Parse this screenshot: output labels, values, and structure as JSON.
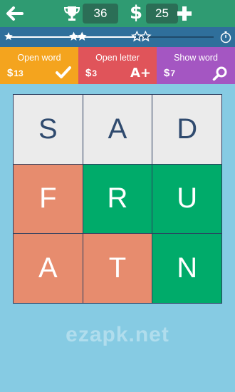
{
  "header": {
    "score": "36",
    "coins": "25",
    "dollar_symbol": "$"
  },
  "progress": {
    "fill_fraction": 0.62
  },
  "hints": [
    {
      "label": "Open word",
      "price": "13",
      "currency": "$",
      "icon": "checkmark-icon"
    },
    {
      "label": "Open letter",
      "price": "3",
      "currency": "$",
      "icon": "a-plus-icon",
      "icon_text": "A+"
    },
    {
      "label": "Show word",
      "price": "7",
      "currency": "$",
      "icon": "magnifier-icon"
    }
  ],
  "grid": {
    "cells": [
      {
        "letter": "S",
        "state": "neutral"
      },
      {
        "letter": "A",
        "state": "neutral"
      },
      {
        "letter": "D",
        "state": "neutral"
      },
      {
        "letter": "F",
        "state": "salmon"
      },
      {
        "letter": "R",
        "state": "green"
      },
      {
        "letter": "U",
        "state": "green"
      },
      {
        "letter": "A",
        "state": "salmon"
      },
      {
        "letter": "T",
        "state": "salmon"
      },
      {
        "letter": "N",
        "state": "green"
      }
    ]
  },
  "colors": {
    "topbar": "#2f9b72",
    "progress_bg": "#2f6f9b",
    "open_word": "#f4a41e",
    "open_letter": "#e0545a",
    "show_word": "#a456c2",
    "neutral_tile": "#ebebeb",
    "salmon_tile": "#e78c6e",
    "green_tile": "#00ab6a",
    "background": "#86cbe3"
  },
  "watermark": "ezapk.net"
}
